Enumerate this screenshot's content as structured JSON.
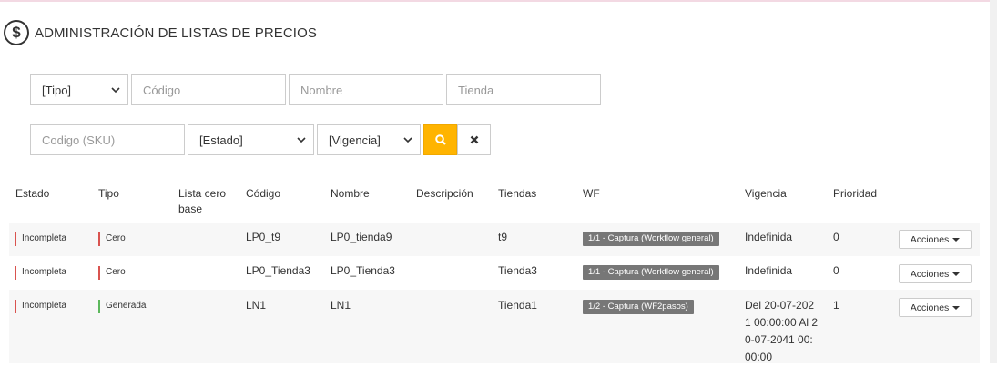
{
  "page": {
    "title": "ADMINISTRACIÓN DE LISTAS DE PRECIOS",
    "icon": "dollar-circle-icon"
  },
  "filters": {
    "tipo": "[Tipo]",
    "codigo_placeholder": "Código",
    "nombre_placeholder": "Nombre",
    "tienda_placeholder": "Tienda",
    "sku_placeholder": "Codigo (SKU)",
    "estado": "[Estado]",
    "vigencia": "[Vigencia]",
    "search_icon": "search-icon",
    "clear_icon": "close-icon",
    "search_color": "#ffb400"
  },
  "table": {
    "headers": {
      "estado": "Estado",
      "tipo": "Tipo",
      "lista_cero_base": "Lista cero base",
      "codigo": "Código",
      "nombre": "Nombre",
      "descripcion": "Descripción",
      "tiendas": "Tiendas",
      "wf": "WF",
      "vigencia": "Vigencia",
      "prioridad": "Prioridad"
    },
    "rows": [
      {
        "estado": "Incompleta",
        "tipo": "Cero",
        "lista_cero_base": "",
        "codigo": "LP0_t9",
        "nombre": "LP0_tienda9",
        "descripcion": "",
        "tiendas": "t9",
        "wf": "1/1 - Captura (Workflow general)",
        "vigencia": "Indefinida",
        "prioridad": "0",
        "acciones": "Acciones"
      },
      {
        "estado": "Incompleta",
        "tipo": "Cero",
        "lista_cero_base": "",
        "codigo": "LP0_Tienda3",
        "nombre": "LP0_Tienda3",
        "descripcion": "",
        "tiendas": "Tienda3",
        "wf": "1/1 - Captura (Workflow general)",
        "vigencia": "Indefinida",
        "prioridad": "0",
        "acciones": "Acciones"
      },
      {
        "estado": "Incompleta",
        "tipo": "Generada",
        "lista_cero_base": "",
        "codigo": "LN1",
        "nombre": "LN1",
        "descripcion": "",
        "tiendas": "Tienda1",
        "wf": "1/2 - Captura (WF2pasos)",
        "vigencia_lines": [
          "Del 20-07-202",
          "1 00:00:00 Al 2",
          "0-07-2041 00:",
          "00:00"
        ],
        "prioridad": "1",
        "acciones": "Acciones"
      }
    ]
  },
  "colors": {
    "status_red": "#d9534f",
    "status_green": "#5cb85c",
    "wf_badge": "#777777"
  }
}
